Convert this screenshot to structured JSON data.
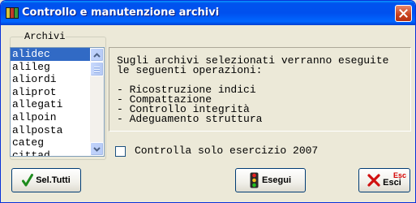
{
  "window": {
    "title": "Controllo e manutenzione archivi"
  },
  "group": {
    "label": "Archivi"
  },
  "archives": {
    "items": [
      "alidec",
      "alileg",
      "aliordi",
      "aliprot",
      "allegati",
      "allpoin",
      "allposta",
      "categ",
      "cittad"
    ],
    "selected": "alidec"
  },
  "info": {
    "intro1": "Sugli archivi selezionati verranno eseguite",
    "intro2": "le seguenti operazioni:",
    "ops": [
      "- Ricostruzione indici",
      "- Compattazione",
      "- Controllo integrità",
      "- Adeguamento struttura"
    ]
  },
  "options": {
    "year_check_label": "Controlla solo esercizio 2007",
    "year_check_checked": false
  },
  "buttons": {
    "select_all": "Sel.Tutti",
    "run": "Esegui",
    "exit": "Esci",
    "exit_shortcut": "Esc"
  },
  "colors": {
    "title_bar": "#0053ee",
    "selection": "#316ac5",
    "close": "#c8401c"
  }
}
